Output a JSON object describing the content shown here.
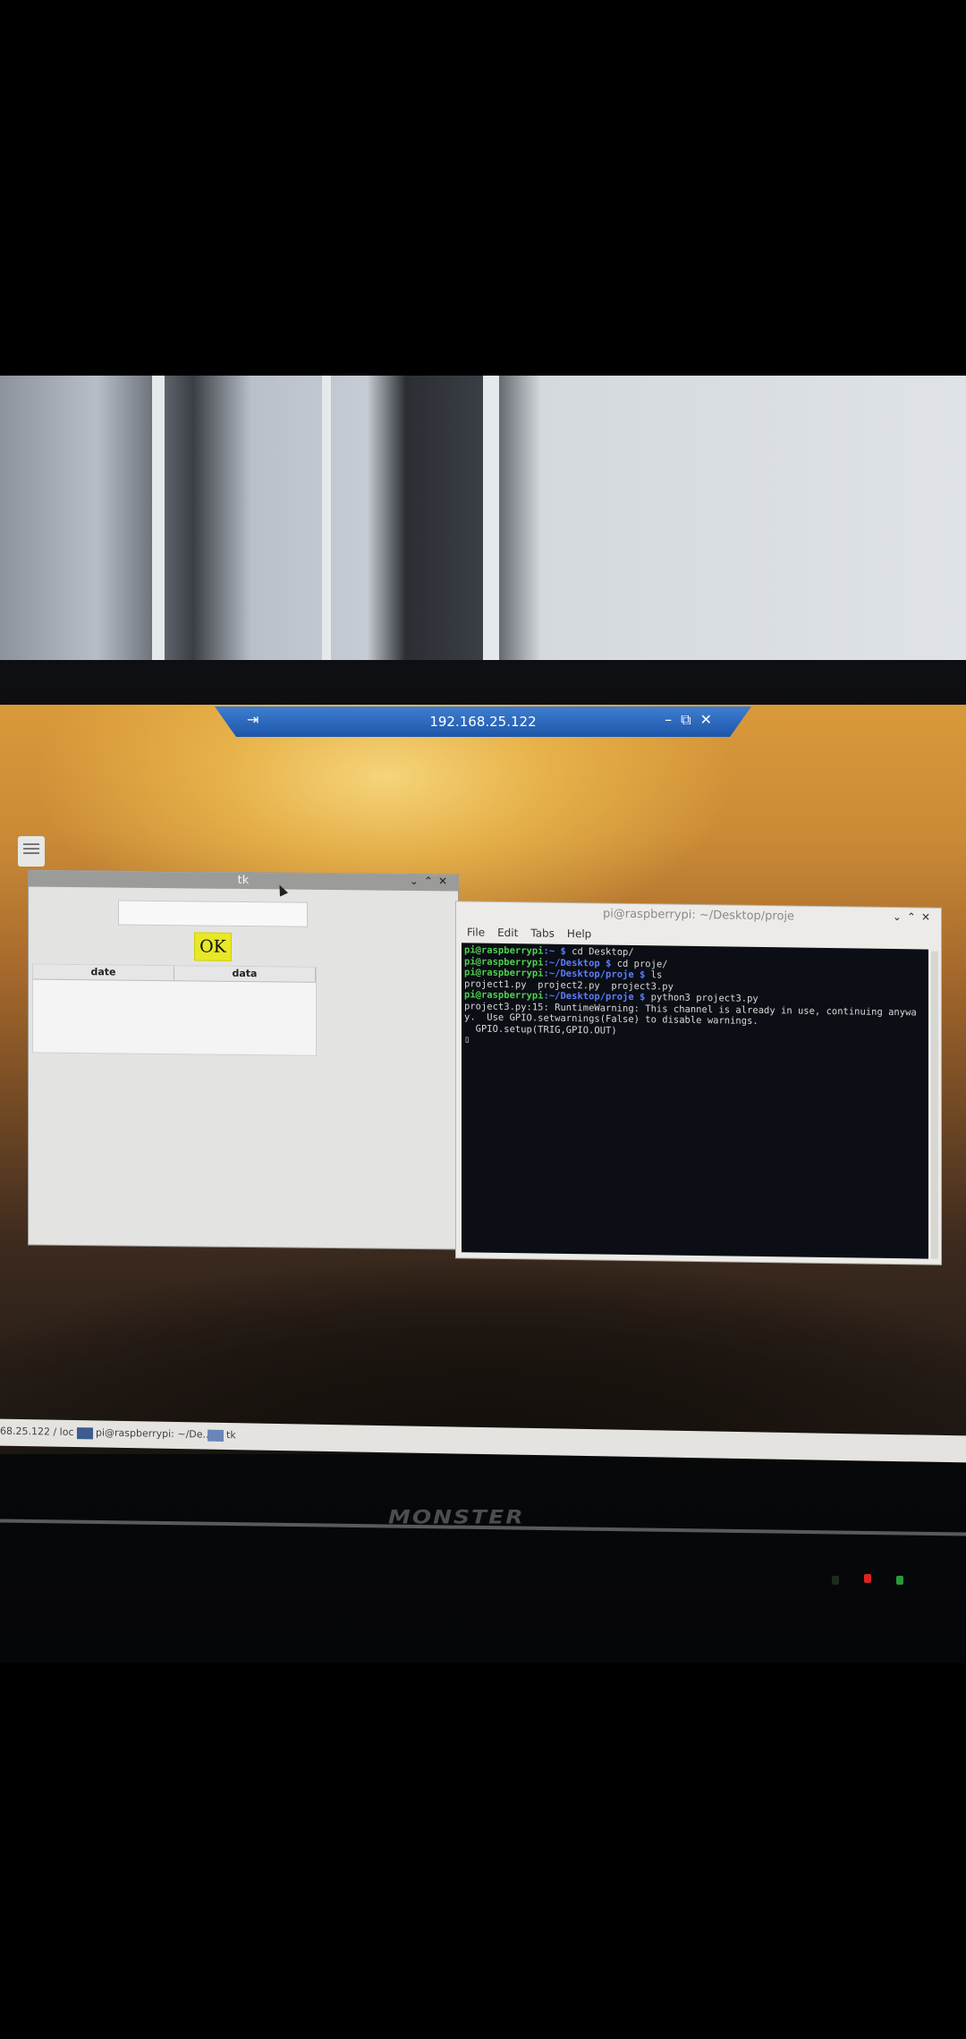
{
  "remote_session": {
    "title": "192.168.25.122",
    "pin_icon": "pin-icon",
    "controls": [
      "minimize-icon",
      "restore-icon",
      "close-icon"
    ]
  },
  "tk_window": {
    "title": "tk",
    "entry_value": "",
    "ok_button": "OK",
    "ok_button_color": "#e8e826",
    "tree_columns": [
      "date",
      "data"
    ],
    "tree_rows": []
  },
  "terminal": {
    "title": "pi@raspberrypi: ~/Desktop/proje",
    "menu": [
      "File",
      "Edit",
      "Tabs",
      "Help"
    ],
    "lines": [
      {
        "prompt_user": "pi@raspberrypi",
        "prompt_path": ":~ $ ",
        "cmd": "cd Desktop/"
      },
      {
        "prompt_user": "pi@raspberrypi",
        "prompt_path": ":~/Desktop $ ",
        "cmd": "cd proje/"
      },
      {
        "prompt_user": "pi@raspberrypi",
        "prompt_path": ":~/Desktop/proje $ ",
        "cmd": "ls"
      },
      {
        "output": "project1.py  project2.py  project3.py"
      },
      {
        "prompt_user": "pi@raspberrypi",
        "prompt_path": ":~/Desktop/proje $ ",
        "cmd": "python3 project3.py"
      },
      {
        "output": "project3.py:15: RuntimeWarning: This channel is already in use, continuing anywa"
      },
      {
        "output": "y.  Use GPIO.setwarnings(False) to disable warnings."
      },
      {
        "output": "  GPIO.setup(TRIG,GPIO.OUT)"
      }
    ]
  },
  "taskbar": {
    "items": [
      "68.25.122 / loc",
      "pi@raspberrypi: ~/De...",
      "tk"
    ]
  },
  "laptop": {
    "brand": "MONSTER"
  }
}
